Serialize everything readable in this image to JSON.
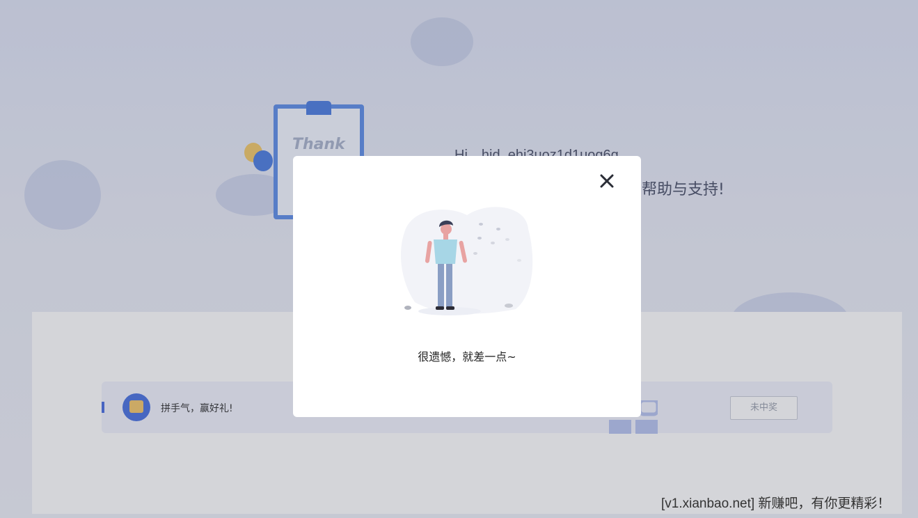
{
  "greeting": {
    "hi": "Hi，hid_ehj3uoz1d1uog6q",
    "thanks": "的帮助与支持!"
  },
  "decor": {
    "clipboard_text": "Thank"
  },
  "prize": {
    "label": "拼手气，赢好礼!",
    "status": "未中奖"
  },
  "modal": {
    "message": "很遗憾，就差一点~"
  },
  "watermark": "[v1.xianbao.net] 新赚吧，有你更精彩！",
  "colors": {
    "accent": "#4b73e0",
    "overlay": "rgba(60,64,80,0.22)"
  }
}
